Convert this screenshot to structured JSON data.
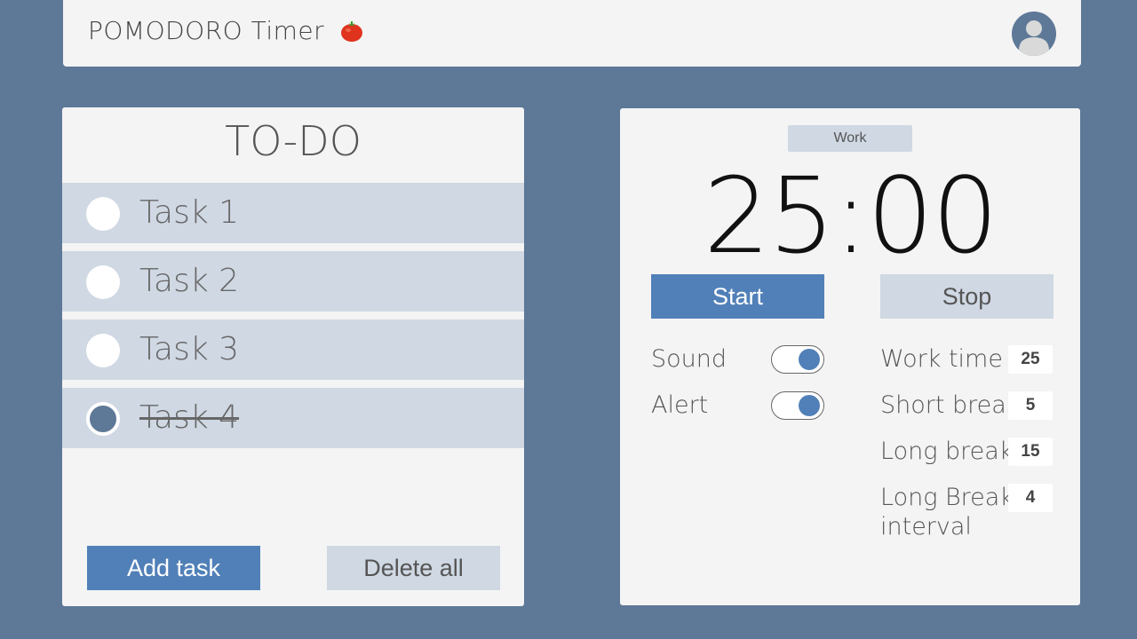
{
  "header": {
    "title": "POMODORO Timer",
    "logo_icon": "tomato-icon",
    "avatar_icon": "user-avatar-icon"
  },
  "todo": {
    "title": "TO-DO",
    "tasks": [
      {
        "label": "Task 1",
        "done": false
      },
      {
        "label": "Task 2",
        "done": false
      },
      {
        "label": "Task 3",
        "done": false
      },
      {
        "label": "Task 4",
        "done": true
      }
    ],
    "add_label": "Add task",
    "delete_label": "Delete all"
  },
  "timer": {
    "mode": "Work",
    "time": "25:00",
    "start_label": "Start",
    "stop_label": "Stop",
    "toggles": [
      {
        "label": "Sound",
        "on": true
      },
      {
        "label": "Alert",
        "on": true
      }
    ],
    "settings": {
      "work_time_label": "Work time",
      "work_time_value": "25",
      "short_break_label": "Short break",
      "short_break_value": "5",
      "long_break_label": "Long break",
      "long_break_value": "15",
      "interval_label_line1": "Long Break",
      "interval_label_line2": "interval",
      "interval_value": "4"
    }
  },
  "colors": {
    "background": "#5e7897",
    "panel": "#f4f4f4",
    "accent": "#5180b8",
    "muted": "#cfd8e3"
  }
}
